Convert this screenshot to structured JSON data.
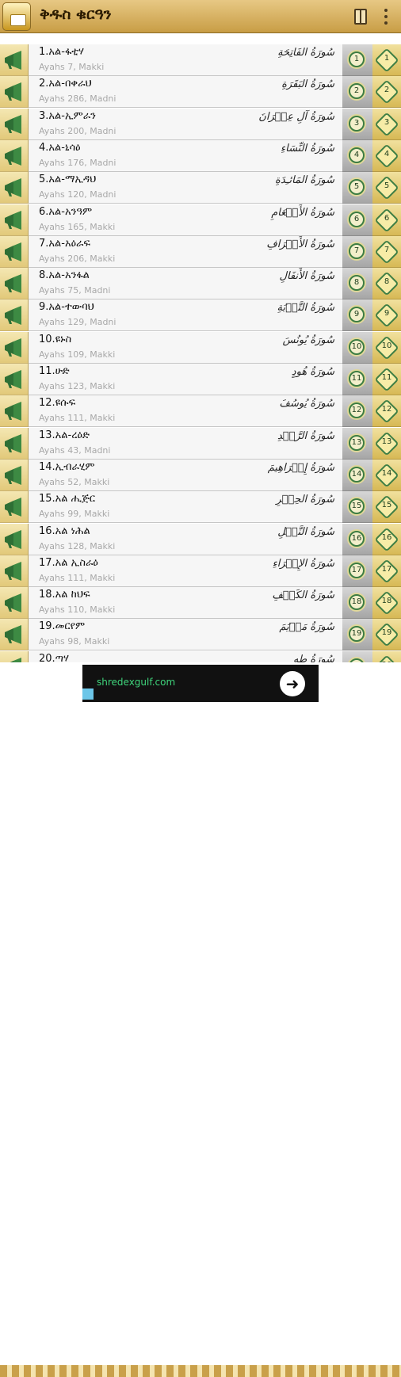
{
  "app": {
    "title": "ቅዱስ ቁርዓን"
  },
  "surahs": [
    {
      "number": 1,
      "title": "1.አል-ፋቲሃ",
      "meta": "Ayahs 7, Makki",
      "arabic": "سُورَةُ الفَاتِحَةِ"
    },
    {
      "number": 2,
      "title": "2.አል-በቀራህ",
      "meta": "Ayahs 286, Madni",
      "arabic": "سُورَةُ البَقَرَةِ"
    },
    {
      "number": 3,
      "title": "3.አል-ኢምራን",
      "meta": "Ayahs 200, Madni",
      "arabic": "سُورَةُ آلِ عِمۡرَانَ"
    },
    {
      "number": 4,
      "title": "4.አል-ኒሳዕ",
      "meta": "Ayahs 176, Madni",
      "arabic": "سُورَةُ النِّسَاءِ"
    },
    {
      "number": 5,
      "title": "5.አል-ማኢዳህ",
      "meta": "Ayahs 120, Madni",
      "arabic": "سُورَةُ المَائـِدَةِ"
    },
    {
      "number": 6,
      "title": "6.አል-አንዓም",
      "meta": "Ayahs 165, Makki",
      "arabic": "سُورَةُ الأَنۡعَامِ"
    },
    {
      "number": 7,
      "title": "7.አል-አዕራፍ",
      "meta": "Ayahs 206, Makki",
      "arabic": "سُورَةُ الأَعۡرَافِ"
    },
    {
      "number": 8,
      "title": "8.አል-አንፋል",
      "meta": "Ayahs 75, Madni",
      "arabic": "سُورَةُ الأَنفَالِ"
    },
    {
      "number": 9,
      "title": "9.አል-ተውባህ",
      "meta": "Ayahs 129, Madni",
      "arabic": "سُورَةُ التَّوۡبَةِ"
    },
    {
      "number": 10,
      "title": "10.ዩኑስ",
      "meta": "Ayahs 109, Makki",
      "arabic": "سُورَةُ يُونُسَ"
    },
    {
      "number": 11,
      "title": "11.ሁድ",
      "meta": "Ayahs 123, Makki",
      "arabic": "سُورَةُ هُودٍ"
    },
    {
      "number": 12,
      "title": "12.ዩሱፍ",
      "meta": "Ayahs 111, Makki",
      "arabic": "سُورَةُ يُوسُفَ"
    },
    {
      "number": 13,
      "title": "13.አል-ረዕድ",
      "meta": "Ayahs 43, Madni",
      "arabic": "سُورَةُ الرَّعۡدِ"
    },
    {
      "number": 14,
      "title": "14.ኢብራሂም",
      "meta": "Ayahs 52, Makki",
      "arabic": "سُورَةُ إِبۡرَاهِيمَ"
    },
    {
      "number": 15,
      "title": "15.አል ሒጅር",
      "meta": "Ayahs 99, Makki",
      "arabic": "سُورَةُ الحِجۡرِ"
    },
    {
      "number": 16,
      "title": "16.አል ነሕል",
      "meta": "Ayahs 128, Makki",
      "arabic": "سُورَةُ النَّحۡلِ"
    },
    {
      "number": 17,
      "title": "17.አል ኢስራዕ",
      "meta": "Ayahs 111, Makki",
      "arabic": "سُورَةُ الإِسۡرَاءِ"
    },
    {
      "number": 18,
      "title": "18.አል ከህፍ",
      "meta": "Ayahs 110, Makki",
      "arabic": "سُورَةُ الكَهۡفِ"
    },
    {
      "number": 19,
      "title": "19.መርየም",
      "meta": "Ayahs 98, Makki",
      "arabic": "سُورَةُ مَرۡيَمَ"
    },
    {
      "number": 20,
      "title": "20.ጣሃ",
      "meta": "",
      "arabic": "سُورَةُ طه"
    }
  ],
  "ad": {
    "url": "shredexgulf.com",
    "go_glyph": "➜"
  },
  "icons": {
    "play": "megaphone-icon",
    "menu": "overflow-menu-icon",
    "book": "bookmark-icon"
  },
  "colors": {
    "appbar": "#d6b061",
    "accent_green": "#3d7d43",
    "gold": "#e2c97a"
  }
}
